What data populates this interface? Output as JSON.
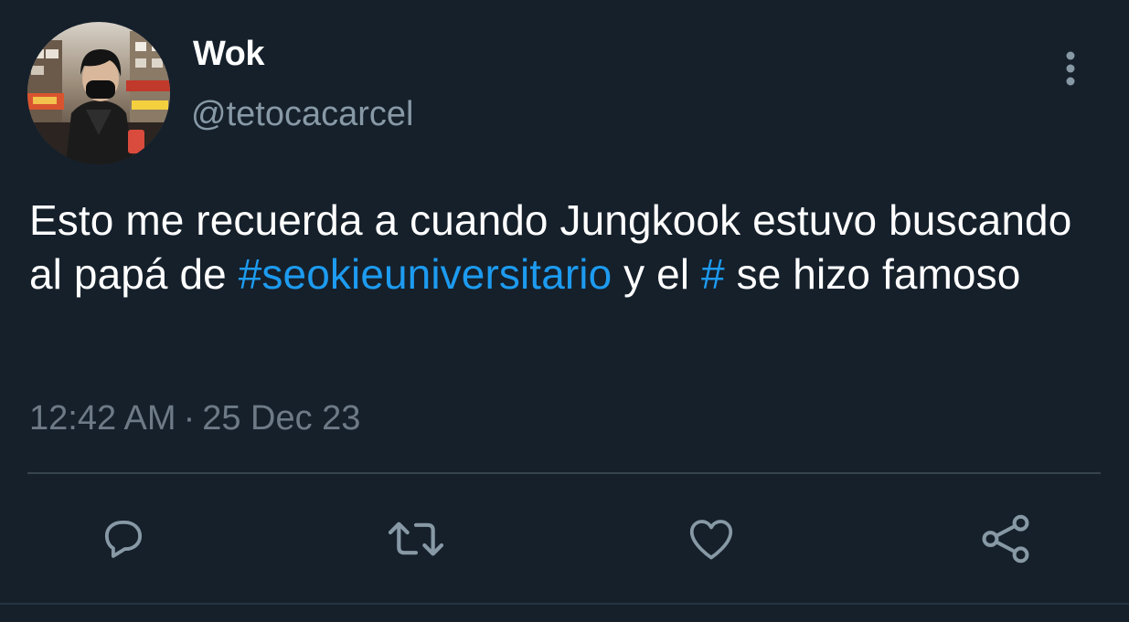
{
  "author": {
    "display_name": "Wok",
    "handle": "@tetocacarcel"
  },
  "tweet": {
    "text_part1": "Esto me recuerda a cuando Jungkook estuvo buscando al papá de ",
    "hashtag1": "#seokieuniversitario",
    "text_part2": " y el ",
    "hashtag2": "#",
    "text_part3": " se hizo famoso",
    "time": "12:42 AM",
    "separator": "·",
    "date": "25 Dec 23"
  },
  "icons": {
    "more": "more-vertical-icon",
    "reply": "reply-icon",
    "retweet": "retweet-icon",
    "like": "heart-icon",
    "share": "share-icon"
  },
  "colors": {
    "background": "#15202b",
    "hashtag": "#1d9bf0",
    "secondary_text": "#8899a6",
    "icon": "#8899a6"
  }
}
